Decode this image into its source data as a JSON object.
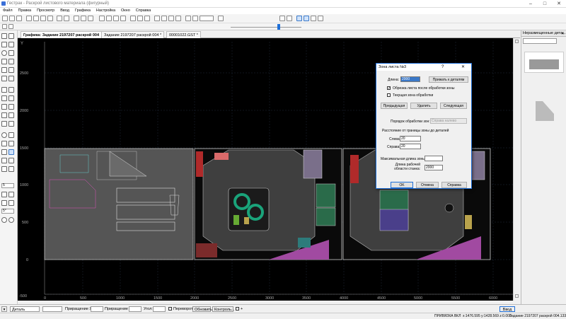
{
  "window": {
    "title": "Гестрак - Раскрой листового материала (фигурный)"
  },
  "menu": [
    "Файл",
    "Правка",
    "Просмотр",
    "Ввод",
    "Графика",
    "Настройка",
    "Окно",
    "Справка"
  ],
  "tabs": [
    {
      "label": "Графика: Задание 2197207 раскрой 004"
    },
    {
      "label": "Задание 2197207 раскрой 004 *"
    },
    {
      "label": "00001022.GST *"
    }
  ],
  "canvas": {
    "x_ticks": [
      "0",
      "500",
      "1000",
      "1500",
      "2000",
      "2500",
      "3000",
      "3500",
      "4000",
      "4500",
      "5000",
      "5500",
      "6000"
    ],
    "y_ticks": [
      "2500",
      "2000",
      "1500",
      "1000",
      "500",
      "0",
      "-500"
    ]
  },
  "left_tools": {
    "step_value": "5",
    "angle_value": "5°"
  },
  "right_panel": {
    "title": "Неразмещенные дета..."
  },
  "dialog": {
    "title": "Зона листа №3",
    "length_label": "Длина:",
    "length_value": "2000",
    "attach_button": "Прижать к деталям",
    "trim_after_label": "Обрезка листа после обработки зоны",
    "trim_after_checked": true,
    "current_zone_label": "Текущая зона обработки",
    "current_zone_checked": false,
    "prev_button": "Предыдущая",
    "delete_button": "Удалить",
    "next_button": "Следующая",
    "order_label": "Порядок обработки зон:",
    "order_value": "Справа налево",
    "distance_label": "Расстояние от границы зоны до деталей",
    "left_label": "Слева:",
    "left_value": "20",
    "right_label": "Справа:",
    "right_value": "20",
    "max_zone_label": "Максимальная длина зоны:",
    "max_zone_value": "",
    "work_length_label": "Длина рабочей области станка:",
    "work_length_value": "2000",
    "ok_button": "OK",
    "cancel_button": "Отмена",
    "help_button": "Справка"
  },
  "bottom_bar": {
    "mode_value": "Деталь",
    "dx_label": "Приращение X:",
    "dy_label": "Приращение Y:",
    "angle_label": "Угол:",
    "flip_label": "Переворот",
    "update_button": "Обновить",
    "control_button": "Контроль...",
    "input_button": "Ввод"
  },
  "status": {
    "snap": "ПРИВЯЗКА ВКЛ",
    "coords": "x:1476.595 y:1428.569 z:0.000",
    "task": "Задание 2197207 раскрой 004.133"
  },
  "colors": {
    "canvas_bg": "#000000",
    "accent": "#1e6fd8"
  }
}
